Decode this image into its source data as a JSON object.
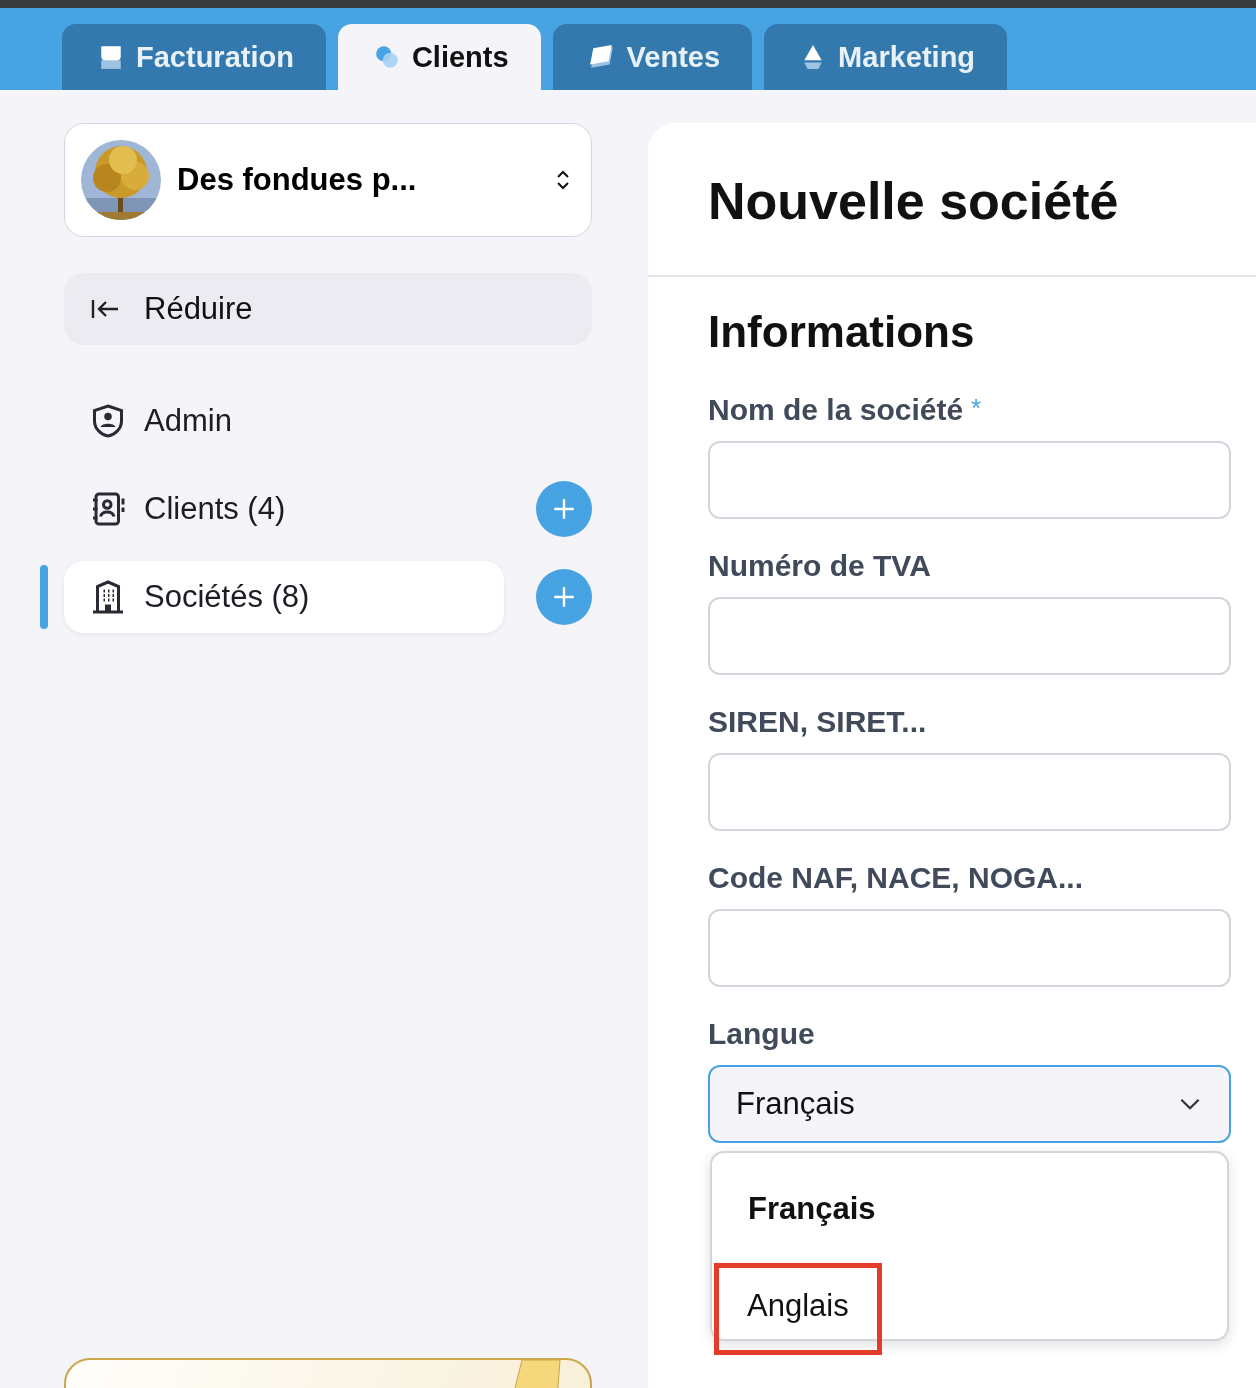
{
  "tabs": [
    {
      "label": "Facturation",
      "selected": false
    },
    {
      "label": "Clients",
      "selected": true
    },
    {
      "label": "Ventes",
      "selected": false
    },
    {
      "label": "Marketing",
      "selected": false
    }
  ],
  "company_switcher": {
    "name": "Des fondues p..."
  },
  "collapse_button": {
    "label": "Réduire"
  },
  "sidebar": {
    "items": [
      {
        "label": "Admin",
        "selected": false,
        "has_add": false
      },
      {
        "label": "Clients (4)",
        "selected": false,
        "has_add": true
      },
      {
        "label": "Sociétés (8)",
        "selected": true,
        "has_add": true
      }
    ]
  },
  "form": {
    "title": "Nouvelle société",
    "section": "Informations",
    "fields": [
      {
        "label": "Nom de la société",
        "required_mark": "*",
        "kind": "text"
      },
      {
        "label": "Numéro de TVA",
        "kind": "text"
      },
      {
        "label": "SIREN, SIRET...",
        "kind": "text"
      },
      {
        "label": "Code NAF, NACE, NOGA...",
        "kind": "text"
      },
      {
        "label": "Langue",
        "kind": "select",
        "value": "Français",
        "open": true,
        "options": [
          {
            "label": "Français",
            "selected": true,
            "highlighted": false
          },
          {
            "label": "Anglais",
            "selected": false,
            "highlighted": true
          }
        ]
      }
    ]
  }
}
